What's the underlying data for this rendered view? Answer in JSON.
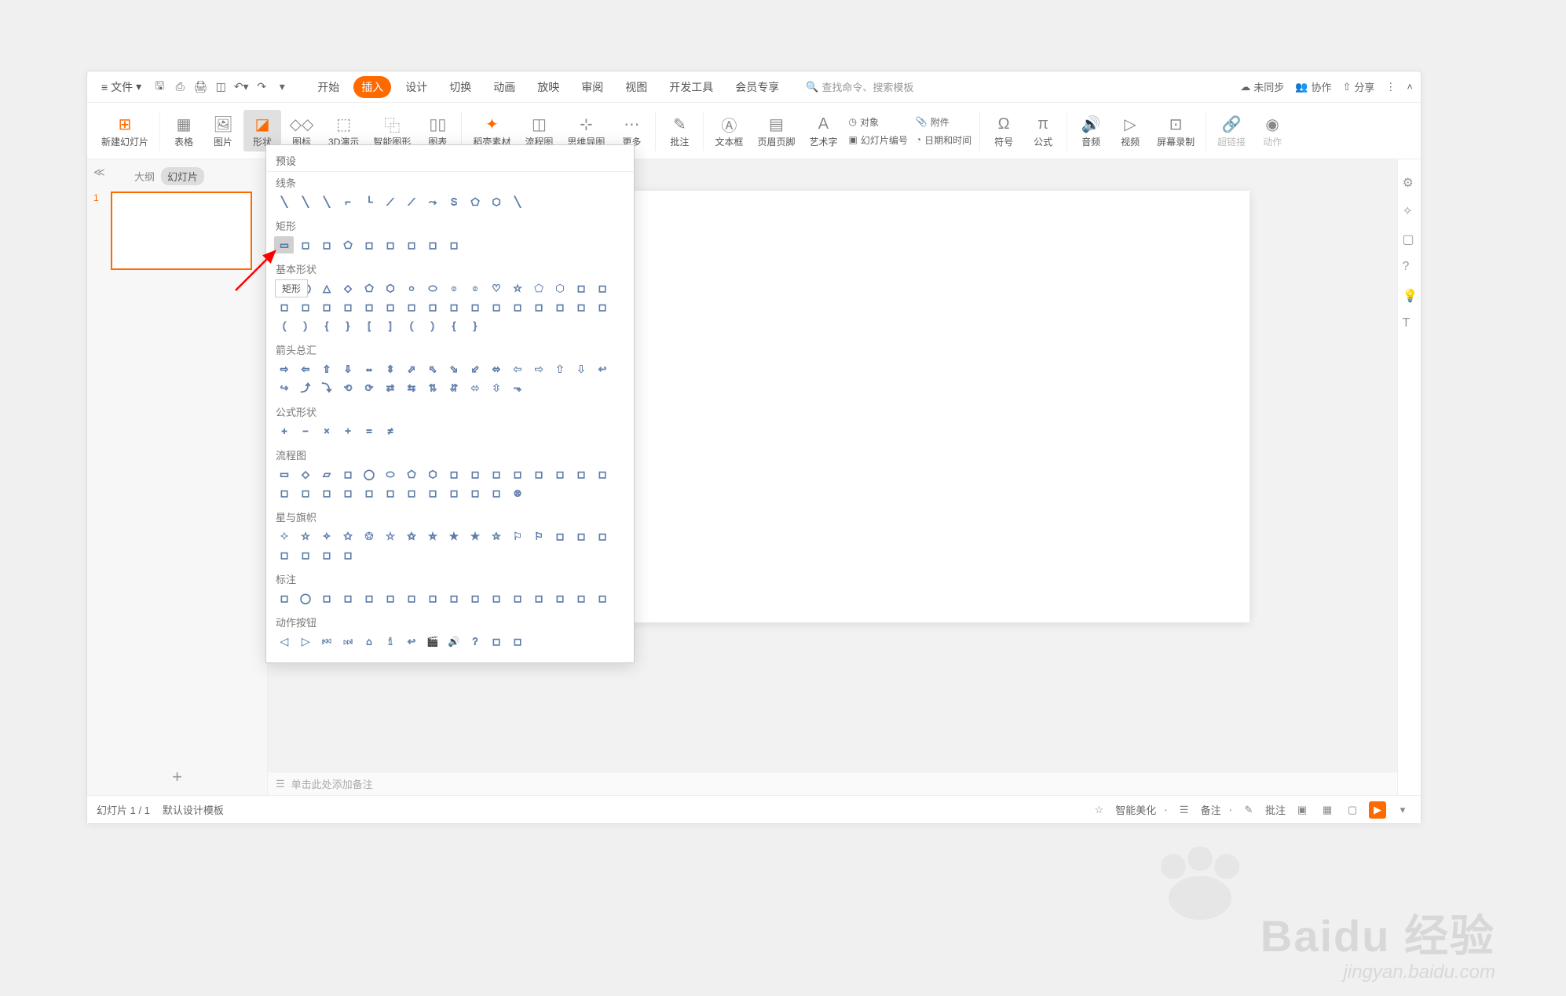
{
  "titlebar": {
    "file_label": "文件",
    "search_placeholder": "查找命令、搜索模板",
    "unsync_label": "未同步",
    "collab_label": "协作",
    "share_label": "分享"
  },
  "tabs": {
    "start": "开始",
    "insert": "插入",
    "design": "设计",
    "transition": "切换",
    "animation": "动画",
    "slideshow": "放映",
    "review": "审阅",
    "view": "视图",
    "dev": "开发工具",
    "member": "会员专享"
  },
  "ribbon": {
    "new_slide": "新建幻灯片",
    "table": "表格",
    "picture": "图片",
    "shapes": "形状",
    "icons": "图标",
    "threed": "3D演示",
    "smart": "智能图形",
    "chart": "图表",
    "docer": "稻壳素材",
    "flow": "流程图",
    "mindmap": "思维导图",
    "more": "更多",
    "comment": "批注",
    "textbox": "文本框",
    "headerfooter": "页眉页脚",
    "wordart": "艺术字",
    "attach": "附件",
    "datetime": "日期和时间",
    "symbol": "符号",
    "equation": "公式",
    "audio": "音频",
    "video": "视频",
    "screenrec": "屏幕录制",
    "hyperlink": "超链接",
    "action": "动作",
    "object": "对象",
    "slidenum": "幻灯片编号"
  },
  "slide_panel": {
    "outline_tab": "大纲",
    "slides_tab": "幻灯片",
    "thumb_number": "1"
  },
  "shapes_dropdown": {
    "header": "预设",
    "tooltip": "矩形",
    "categories": {
      "lines": "线条",
      "rects": "矩形",
      "basic": "基本形状",
      "arrows": "箭头总汇",
      "equation": "公式形状",
      "flowchart": "流程图",
      "stars": "星与旗帜",
      "callouts": "标注",
      "actions": "动作按钮"
    }
  },
  "notes": {
    "placeholder": "单击此处添加备注"
  },
  "statusbar": {
    "slide_count": "幻灯片 1 / 1",
    "template": "默认设计模板",
    "beautify": "智能美化",
    "notes_btn": "备注",
    "comments_btn": "批注"
  },
  "watermark": {
    "main": "Baidu 经验",
    "sub": "jingyan.baidu.com"
  },
  "shape_counts": {
    "lines": 12,
    "rects": 9,
    "basic": 42,
    "arrows": 28,
    "equation": 6,
    "flowchart": 28,
    "stars": 20,
    "callouts": 16,
    "actions": 12
  }
}
